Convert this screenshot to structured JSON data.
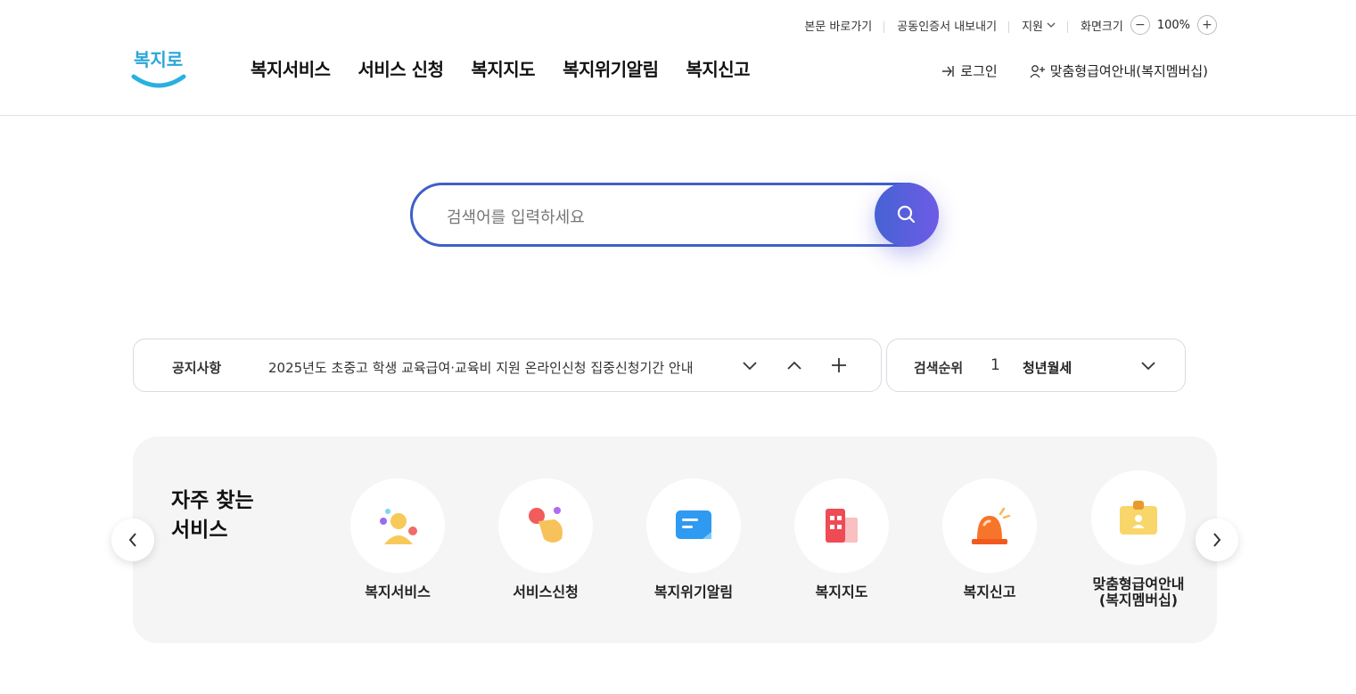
{
  "utility": {
    "skip_to_content": "본문 바로가기",
    "cert_export": "공동인증서 내보내기",
    "support": "지원",
    "screen_size_label": "화면크기",
    "zoom_minus": "−",
    "zoom_value": "100%",
    "zoom_plus": "+"
  },
  "header": {
    "logo_text": "복지로",
    "nav": [
      "복지서비스",
      "서비스 신청",
      "복지지도",
      "복지위기알림",
      "복지신고"
    ],
    "login": "로그인",
    "membership": "맞춤형급여안내(복지멤버십)"
  },
  "search": {
    "placeholder": "검색어를 입력하세요"
  },
  "notice": {
    "label": "공지사항",
    "text": "2025년도 초중고 학생 교육급여·교육비 지원 온라인신청 집중신청기간 안내"
  },
  "ranking": {
    "label": "검색순위",
    "rank": "1",
    "keyword": "청년월세"
  },
  "frequent": {
    "title_line1": "자주 찾는",
    "title_line2": "서비스",
    "items": [
      {
        "label": "복지서비스",
        "icon": "person-icon"
      },
      {
        "label": "서비스신청",
        "icon": "hand-click-icon"
      },
      {
        "label": "복지위기알림",
        "icon": "message-icon"
      },
      {
        "label": "복지지도",
        "icon": "building-icon"
      },
      {
        "label": "복지신고",
        "icon": "siren-icon"
      },
      {
        "label": "맞춤형급여안내\n(복지멤버십)",
        "icon": "id-card-icon"
      }
    ]
  },
  "colors": {
    "accent": "#3f5fc8",
    "accent2": "#6e5be6",
    "panel_bg": "#f5f5f5"
  }
}
